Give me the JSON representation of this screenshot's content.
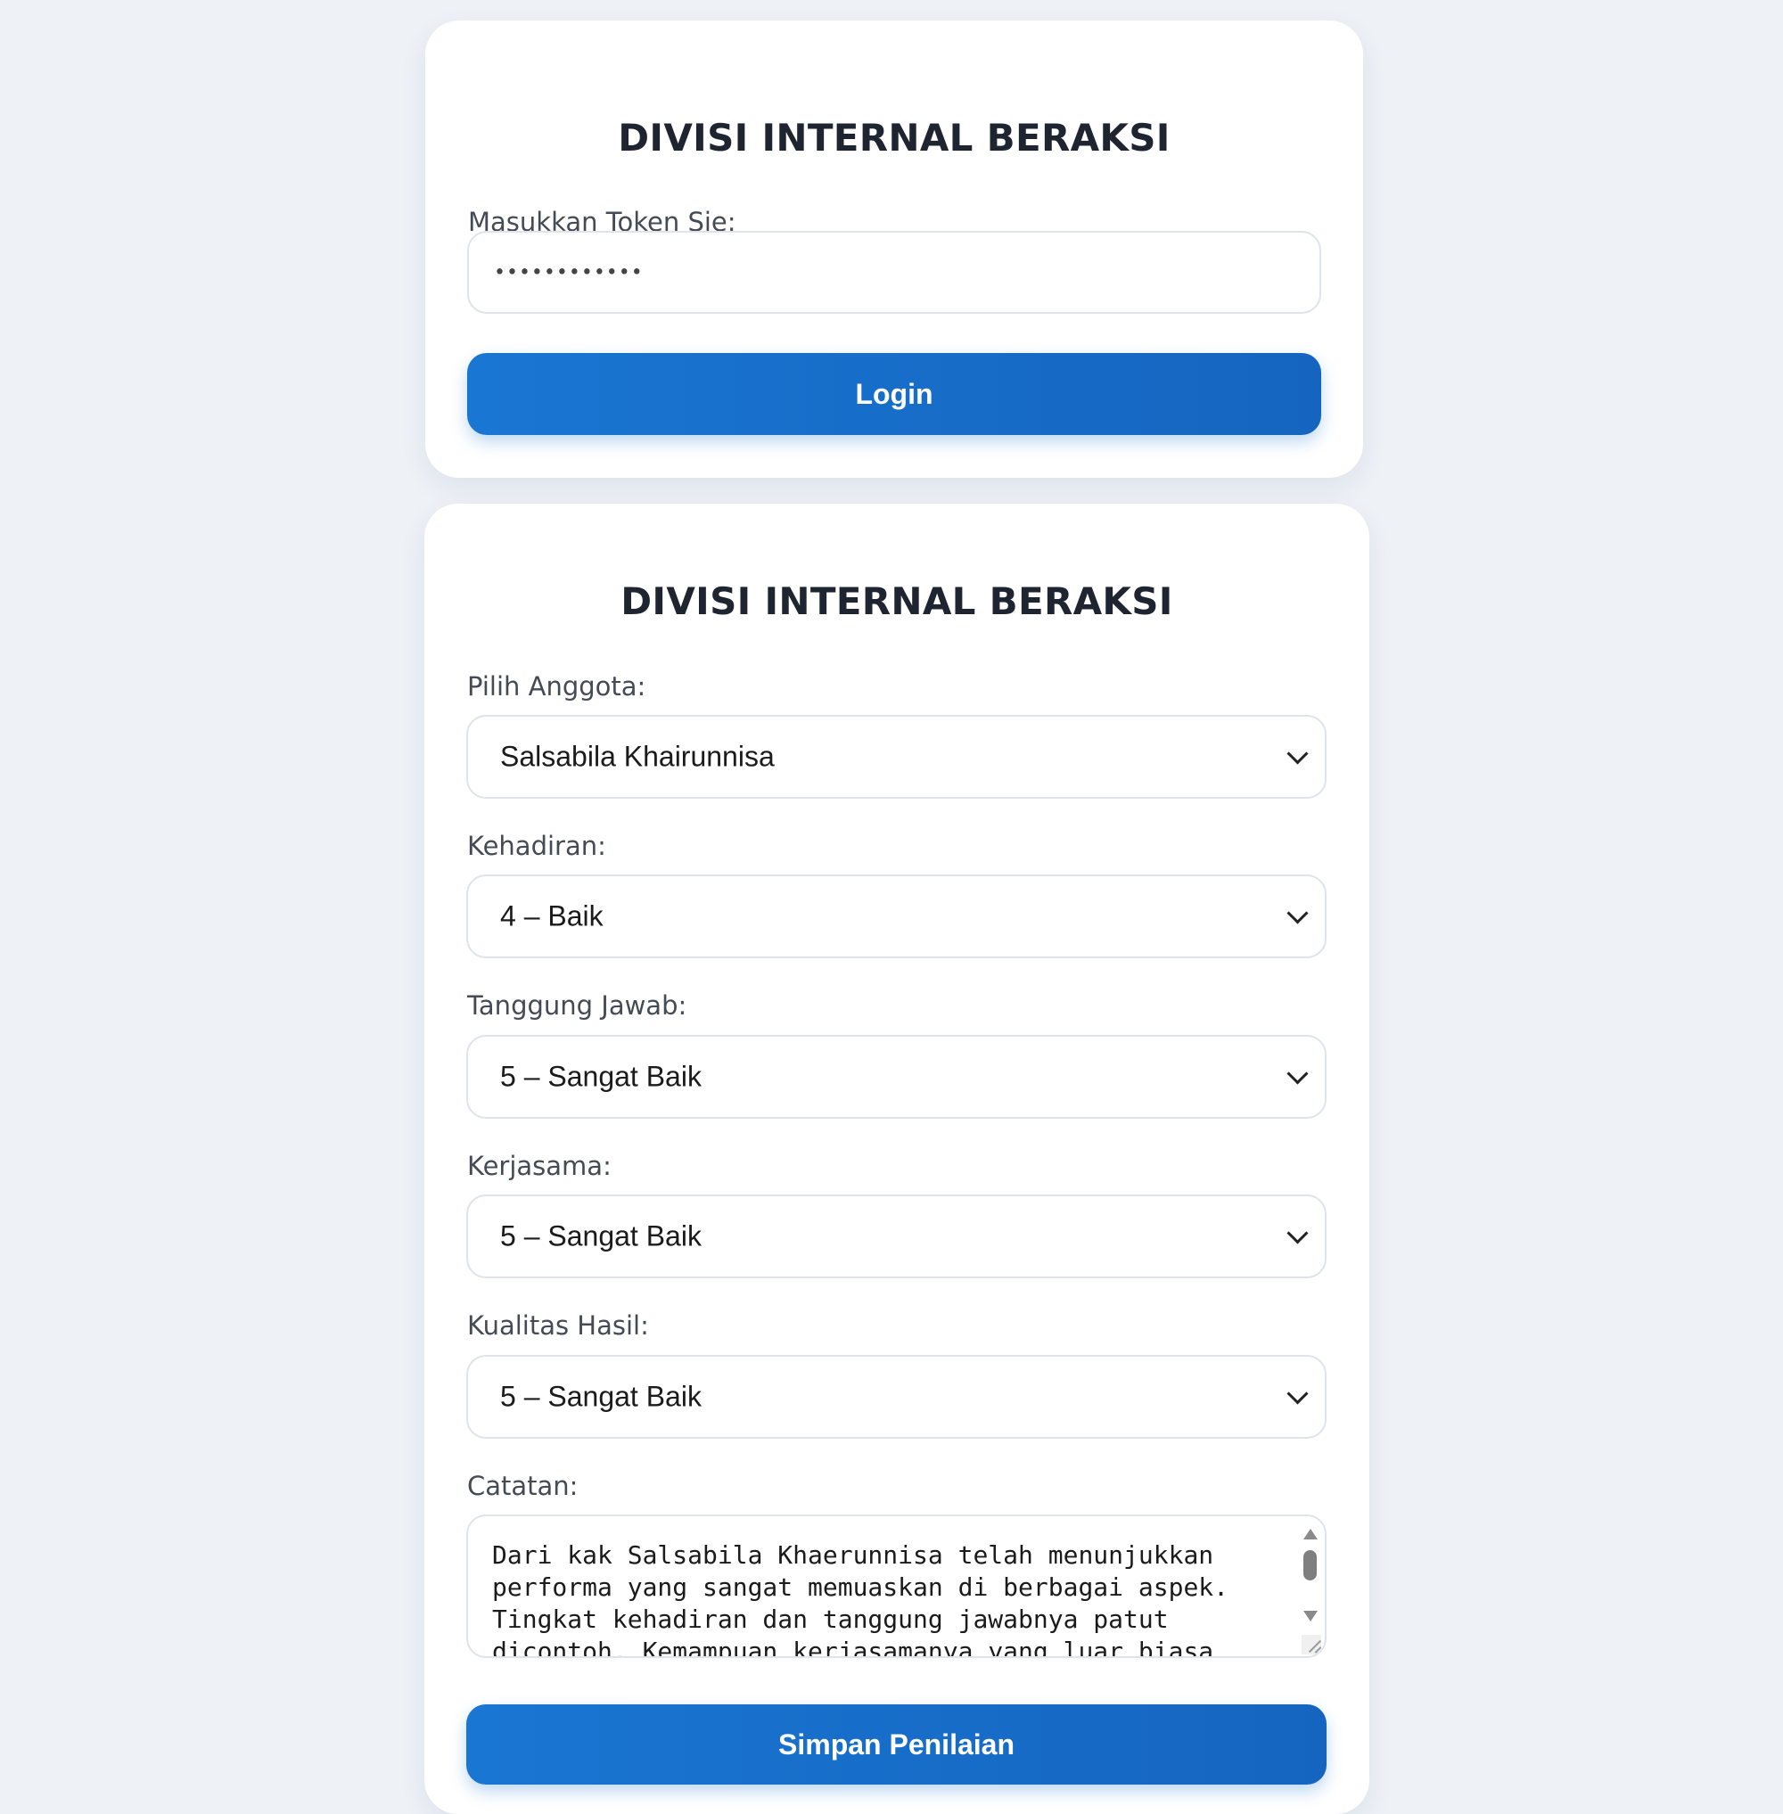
{
  "login_card": {
    "title": "DIVISI INTERNAL BERAKSI",
    "token_label": "Masukkan Token Sie:",
    "token_value": "••••••••••••",
    "login_button": "Login"
  },
  "rating_card": {
    "title": "DIVISI INTERNAL BERAKSI",
    "member": {
      "label": "Pilih Anggota:",
      "selected": "Salsabila Khairunnisa"
    },
    "attendance": {
      "label": "Kehadiran:",
      "selected": "4 – Baik"
    },
    "responsibility": {
      "label": "Tanggung Jawab:",
      "selected": "5 – Sangat Baik"
    },
    "teamwork": {
      "label": "Kerjasama:",
      "selected": "5 – Sangat Baik"
    },
    "quality": {
      "label": "Kualitas Hasil:",
      "selected": "5 – Sangat Baik"
    },
    "notes": {
      "label": "Catatan:",
      "value": "Dari kak Salsabila Khaerunnisa telah menunjukkan\nperforma yang sangat memuaskan di berbagai aspek.\nTingkat kehadiran dan tanggung jawabnya patut\ndicontoh. Kemampuan kerjasamanya yang luar biasa"
    },
    "save_button": "Simpan Penilaian"
  },
  "colors": {
    "background": "#eef1f6",
    "card": "#ffffff",
    "primary": "#1976d2",
    "border": "#dfe3ea",
    "title_text": "#1f2530",
    "label_text": "#444b55"
  },
  "icons": {
    "select_chevron": "chevron-down-icon",
    "scroll_up": "arrow-up-icon",
    "scroll_down": "arrow-down-icon",
    "resize": "resize-grip-icon"
  }
}
